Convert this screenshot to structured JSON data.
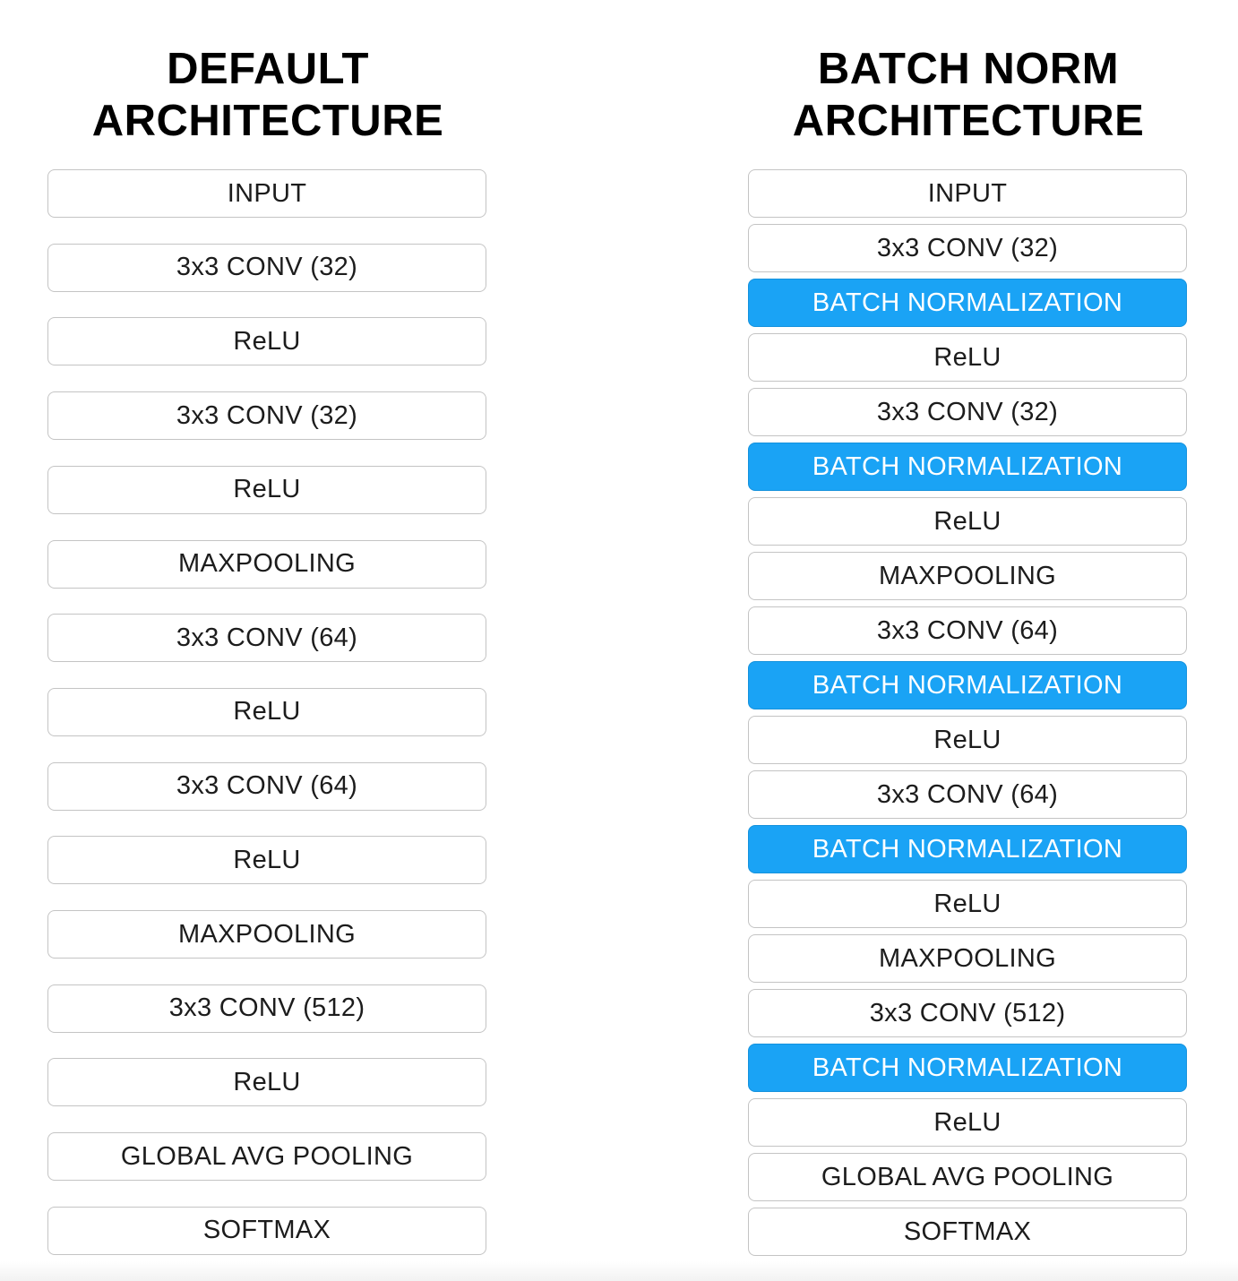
{
  "columns": [
    {
      "id": "default",
      "title_lines": [
        "DEFAULT",
        "ARCHITECTURE"
      ],
      "layers": [
        "INPUT",
        "3x3 CONV (32)",
        "ReLU",
        "3x3 CONV (32)",
        "ReLU",
        "MAXPOOLING",
        "3x3 CONV (64)",
        "ReLU",
        "3x3 CONV (64)",
        "ReLU",
        "MAXPOOLING",
        "3x3 CONV (512)",
        "ReLU",
        "GLOBAL AVG POOLING",
        "SOFTMAX"
      ]
    },
    {
      "id": "batch-norm",
      "title_lines": [
        "BATCH NORM",
        "ARCHITECTURE"
      ],
      "layers": [
        "INPUT",
        "3x3 CONV (32)",
        "BATCH NORMALIZATION",
        "ReLU",
        "3x3 CONV (32)",
        "BATCH NORMALIZATION",
        "ReLU",
        "MAXPOOLING",
        "3x3 CONV (64)",
        "BATCH NORMALIZATION",
        "ReLU",
        "3x3 CONV (64)",
        "BATCH NORMALIZATION",
        "ReLU",
        "MAXPOOLING",
        "3x3 CONV (512)",
        "BATCH NORMALIZATION",
        "ReLU",
        "GLOBAL AVG POOLING",
        "SOFTMAX"
      ]
    }
  ],
  "colors": {
    "highlight": "#1aa3f5",
    "box_border": "#c4c4c4",
    "text": "#1c1c1c"
  }
}
